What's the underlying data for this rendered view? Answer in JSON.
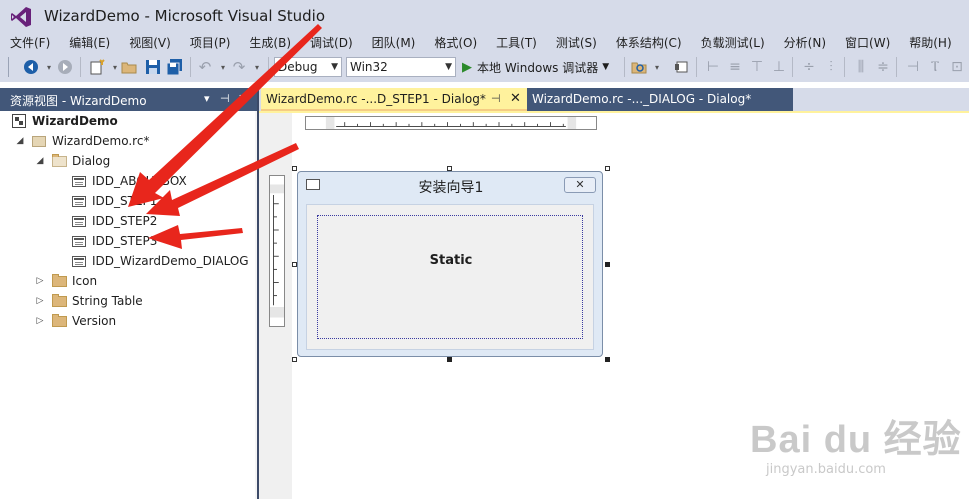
{
  "window": {
    "title": "WizardDemo - Microsoft Visual Studio"
  },
  "menu": [
    "文件(F)",
    "编辑(E)",
    "视图(V)",
    "项目(P)",
    "生成(B)",
    "调试(D)",
    "团队(M)",
    "格式(O)",
    "工具(T)",
    "测试(S)",
    "体系结构(C)",
    "负载测试(L)",
    "分析(N)",
    "窗口(W)",
    "帮助(H)"
  ],
  "toolbar": {
    "config": "Debug",
    "platform": "Win32",
    "run_label": "本地 Windows 调试器"
  },
  "resource_view": {
    "title": "资源视图 - WizardDemo",
    "root": "WizardDemo",
    "rc_file": "WizardDemo.rc*",
    "dialog_folder": "Dialog",
    "dialogs": [
      "IDD_ABOUTBOX",
      "IDD_STEP1",
      "IDD_STEP2",
      "IDD_STEP3",
      "IDD_WizardDemo_DIALOG"
    ],
    "folders": [
      "Icon",
      "String Table",
      "Version"
    ]
  },
  "tabs": {
    "active": "WizardDemo.rc -...D_STEP1 - Dialog*",
    "inactive": "WizardDemo.rc -..._DIALOG - Dialog*"
  },
  "dialog": {
    "title": "安装向导1",
    "static_label": "Static"
  },
  "watermark": {
    "main": "Bai du 经验",
    "sub": "jingyan.baidu.com"
  },
  "colors": {
    "chrome": "#d6dbe9",
    "panel_header": "#425779",
    "active_tab": "#fff29d",
    "arrow": "#e8261c"
  }
}
